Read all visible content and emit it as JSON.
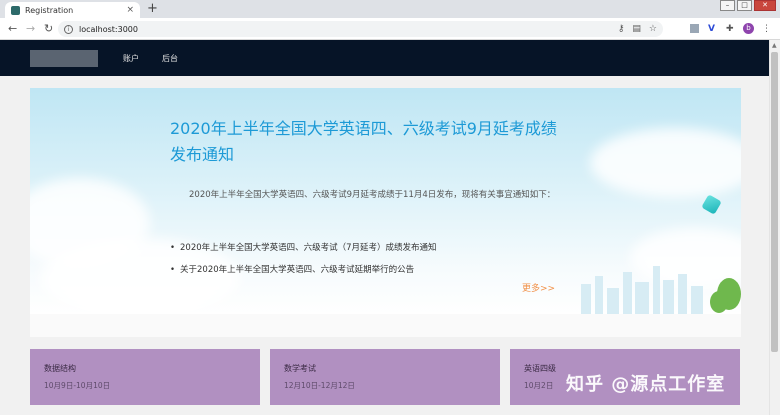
{
  "browser": {
    "tab_title": "Registration",
    "tab_close": "×",
    "new_tab": "+",
    "url": "localhost:3000",
    "avatar_letter": "b",
    "window_controls": [
      "–",
      "□",
      "✕"
    ]
  },
  "site": {
    "nav": [
      "账户",
      "后台"
    ]
  },
  "banner": {
    "title": "2020年上半年全国大学英语四、六级考试9月延考成绩发布通知",
    "description": "2020年上半年全国大学英语四、六级考试9月延考成绩于11月4日发布，现将有关事宜通知如下：",
    "bullets": [
      "2020年上半年全国大学英语四、六级考试（7月延考）成绩发布通知",
      "关于2020年上半年全国大学英语四、六级考试延期举行的公告"
    ],
    "more_label": "更多>>"
  },
  "cards": [
    {
      "title": "数据结构",
      "date": "10月9日-10月10日"
    },
    {
      "title": "数学考试",
      "date": "12月10日-12月12日"
    },
    {
      "title": "英语四级",
      "date": "10月2日"
    }
  ],
  "watermark": "知乎 @源点工作室"
}
